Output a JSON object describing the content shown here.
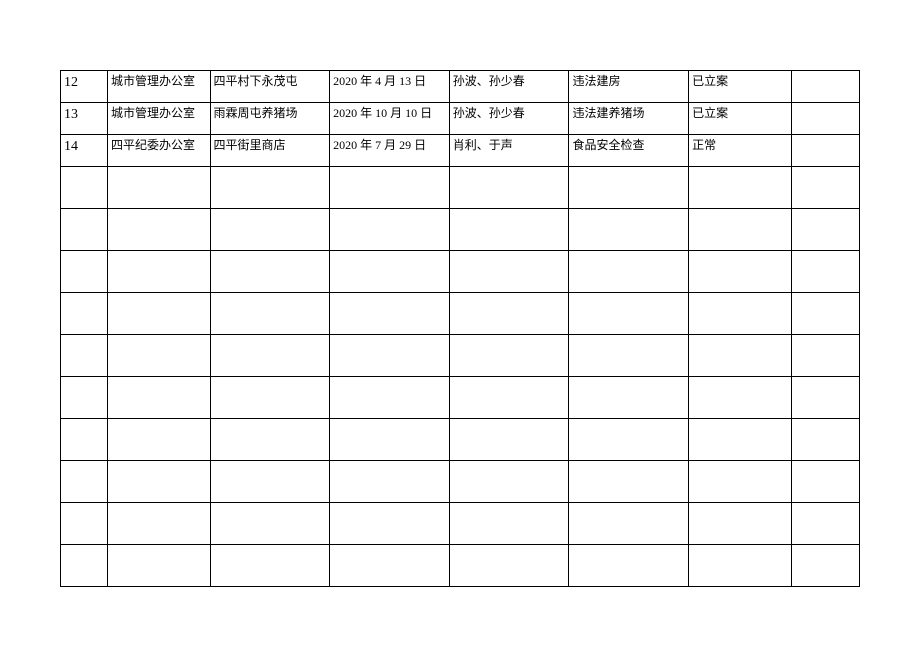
{
  "rows": [
    {
      "num": "12",
      "dept": "城市管理办公室",
      "location": "四平村下永茂屯",
      "date": "2020 年 4 月 13 日",
      "persons": "孙波、孙少春",
      "matter": "违法建房",
      "status": "已立案",
      "note": ""
    },
    {
      "num": "13",
      "dept": "城市管理办公室",
      "location": "雨霖周屯养猪场",
      "date": "2020 年 10 月 10 日",
      "persons": "孙波、孙少春",
      "matter": "违法建养猪场",
      "status": "已立案",
      "note": ""
    },
    {
      "num": "14",
      "dept": "四平纪委办公室",
      "location": "四平街里商店",
      "date": "2020 年 7 月 29 日",
      "persons": "肖利、于声",
      "matter": "食品安全检查",
      "status": "正常",
      "note": ""
    }
  ],
  "emptyRowCount": 10
}
